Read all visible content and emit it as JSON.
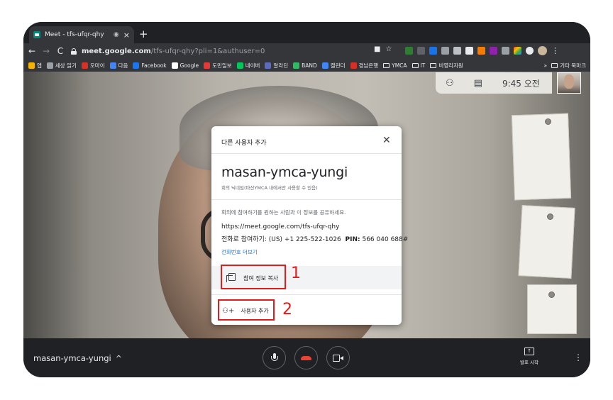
{
  "browser": {
    "tab": {
      "title": "Meet - tfs-ufqr-qhy",
      "audio": "◉",
      "close": "×"
    },
    "new_tab": "+",
    "nav": {
      "back": "←",
      "forward": "→",
      "reload": "C"
    },
    "url_host": "meet.google.com",
    "url_path": "/tfs-ufqr-qhy?pli=1&authuser=0",
    "omni_icons": [
      "■",
      "☆"
    ],
    "menu": "⋮",
    "bookmarks": [
      {
        "label": "앱",
        "color": "#f4b400"
      },
      {
        "label": "세상 읽기",
        "color": "#9aa0a6"
      },
      {
        "label": "오마이",
        "color": "#d93025"
      },
      {
        "label": "다음",
        "color": "#4285f4"
      },
      {
        "label": "Facebook",
        "color": "#1877f2"
      },
      {
        "label": "Google",
        "color": "#ffffff"
      },
      {
        "label": "도민일보",
        "color": "#e53935"
      },
      {
        "label": "네이버",
        "color": "#03c75a"
      },
      {
        "label": "알라딘",
        "color": "#5c6bc0"
      },
      {
        "label": "BAND",
        "color": "#2dbd60"
      },
      {
        "label": "캘린더",
        "color": "#4285f4"
      },
      {
        "label": "경남은행",
        "color": "#d93025"
      }
    ],
    "bookmark_folders": [
      "YMCA",
      "IT",
      "비영리지원"
    ],
    "bookmarks_overflow": "»",
    "bookmarks_other": "기타 북마크"
  },
  "meet": {
    "clock": "9:45 오전",
    "people_icon": "⚇",
    "chat_icon": "▤"
  },
  "dialog": {
    "title": "다른 사용자 추가",
    "close": "✕",
    "meeting_name": "masan-ymca-yungi",
    "nickname_note": "회의 닉네임(마산YMCA 내에서만 사용할 수 있음)",
    "share_text": "회의에 참여하기를 원하는 사람과 이 정보를 공유하세요.",
    "link": "https://meet.google.com/tfs-ufqr-qhy",
    "phone_prefix": "전화로 참여하기: (US) +1 225-522-1026",
    "pin_label": "PIN:",
    "pin_value": "566 040 688#",
    "more_phones": "전화번호 더보기",
    "copy_label": "참여 정보 복사",
    "add_label": "사용자 추가",
    "add_icon": "⚇+"
  },
  "annotations": {
    "one": "1",
    "two": "2"
  },
  "bottom": {
    "meeting_name": "masan-ymca-yungi",
    "chevron": "^",
    "present_label": "발표 시작",
    "present_icon": "↑",
    "more": "⋮"
  },
  "colors": {
    "accent": "#1a73e8",
    "annotation": "#e21b1b",
    "hangup": "#ea4335"
  }
}
